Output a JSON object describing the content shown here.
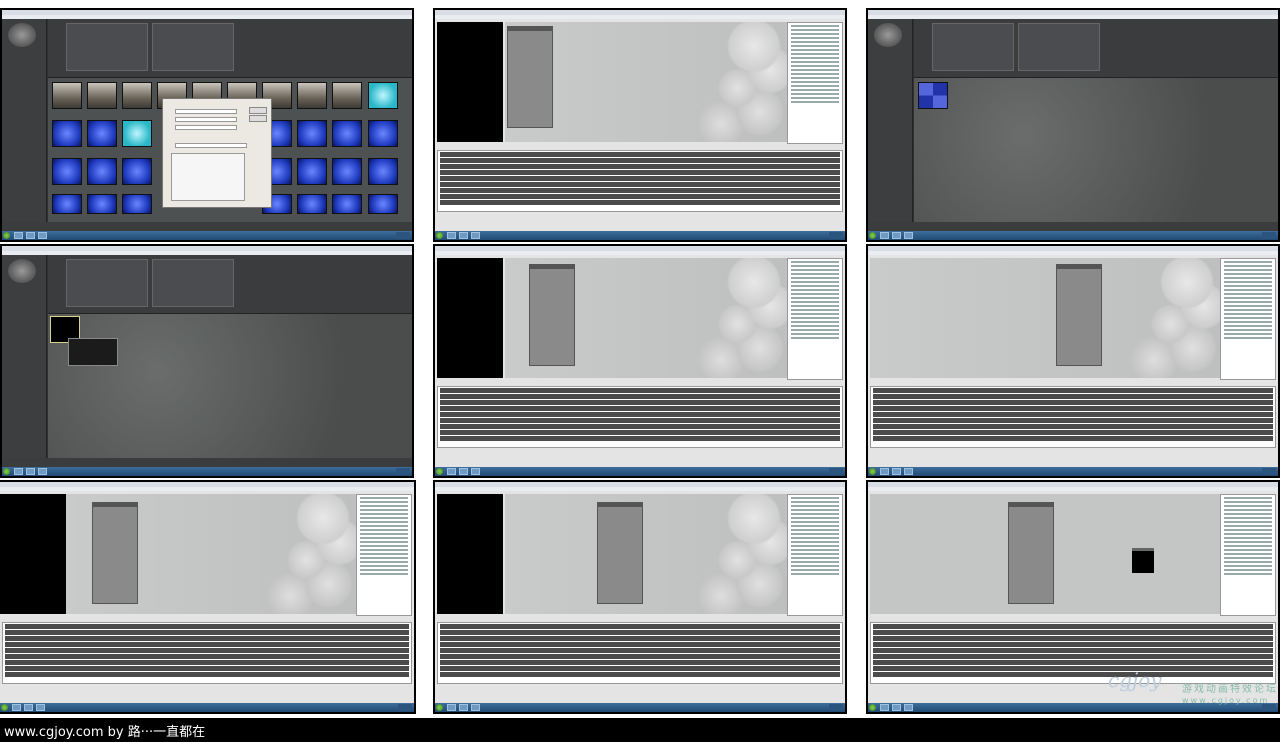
{
  "footer": {
    "credit": "www.cgjoy.com by 路···一直都在"
  },
  "watermark": {
    "logo": "cgjoy",
    "tagline": "游戏动画特效论坛",
    "url": "www.cgjoy.com"
  },
  "frames": [
    {
      "id": "1",
      "view": "content-browser-import-dialog"
    },
    {
      "id": "2",
      "view": "material-editor"
    },
    {
      "id": "3",
      "view": "content-browser-texture"
    },
    {
      "id": "4",
      "view": "content-browser-tooltip"
    },
    {
      "id": "5",
      "view": "material-editor"
    },
    {
      "id": "6",
      "view": "material-editor"
    },
    {
      "id": "7",
      "view": "material-editor-fullwidth"
    },
    {
      "id": "8",
      "view": "material-editor"
    },
    {
      "id": "9",
      "view": "material-editor-black-node"
    }
  ],
  "colors": {
    "desktop_bg": "#ffffff",
    "footer_bg": "#000000",
    "taskbar": "#204a72",
    "material_blue": "#1f3bbf",
    "preview_black": "#000000"
  }
}
